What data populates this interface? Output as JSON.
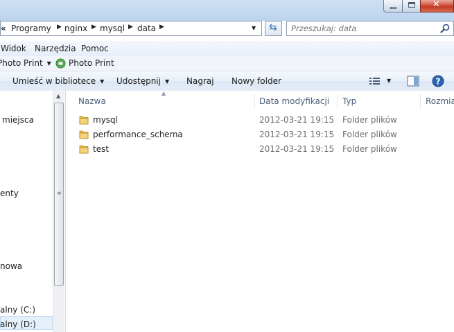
{
  "window": {
    "controls": {
      "minimize": "minimize",
      "maximize": "maximize",
      "close": "✕"
    }
  },
  "address": {
    "overflow": "«",
    "crumbs": [
      "Programy",
      "nginx",
      "mysql",
      "data"
    ],
    "search_placeholder": "Przeszukaj: data"
  },
  "menu": {
    "items": [
      "Widok",
      "Narzędzia",
      "Pomoc"
    ]
  },
  "photobar": {
    "item1": "Photo Print",
    "item2": "Photo Print"
  },
  "toolbar": {
    "include_library": "Umieść w bibliotece",
    "share": "Udostępnij",
    "burn": "Nagraj",
    "new_folder": "Nowy folder"
  },
  "nav": {
    "items": [
      "miejsca",
      "enty",
      "nowa",
      "alny (C:)",
      "alny (D:)"
    ]
  },
  "columns": {
    "name": "Nazwa",
    "date": "Data modyfikacji",
    "type": "Typ",
    "size": "Rozmiar"
  },
  "files": [
    {
      "name": "mysql",
      "date": "2012-03-21 19:15",
      "type": "Folder plików"
    },
    {
      "name": "performance_schema",
      "date": "2012-03-21 19:15",
      "type": "Folder plików"
    },
    {
      "name": "test",
      "date": "2012-03-21 19:15",
      "type": "Folder plików"
    }
  ],
  "colors": {
    "folder": "#e8b94a",
    "accent": "#2f6fb8"
  }
}
